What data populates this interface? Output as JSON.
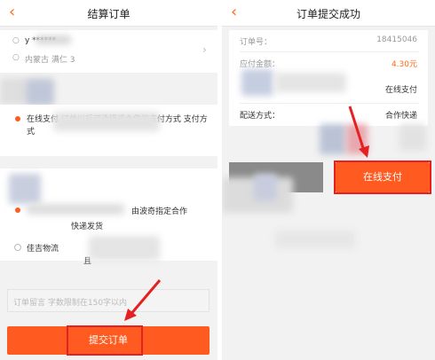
{
  "left": {
    "title": "结算订单",
    "address": {
      "name": "y ******",
      "line": "内蒙古 满仁 3"
    },
    "payment_note": "在线支付 订单以后可选择适合您的支付方式 支付方式",
    "delivery_note": "由波奇指定合作 快递发货",
    "alt_option": {
      "label": "佳吉物流",
      "sub": "且"
    },
    "message": {
      "placeholder": "订单留言 字数限制在150字以内"
    },
    "submit_label": "提交订单"
  },
  "right": {
    "title": "订单提交成功",
    "order_no_label": "订单号：",
    "order_no": "18415046",
    "amount_label": "应付金额：",
    "amount": "4.30元",
    "pay_method": "在线支付",
    "shipping_label": "配送方式：",
    "shipping_value": "合作快递",
    "pay_button_label": "在线支付"
  },
  "colors": {
    "accent": "#ff5a1f",
    "highlight": "#e62020",
    "amount": "#ff6a1a",
    "gray_button": "#8a8a8a"
  },
  "icons": {
    "back": "chevron-left-icon",
    "chevron": "chevron-right-icon",
    "pointer": "red-arrow-icon"
  }
}
